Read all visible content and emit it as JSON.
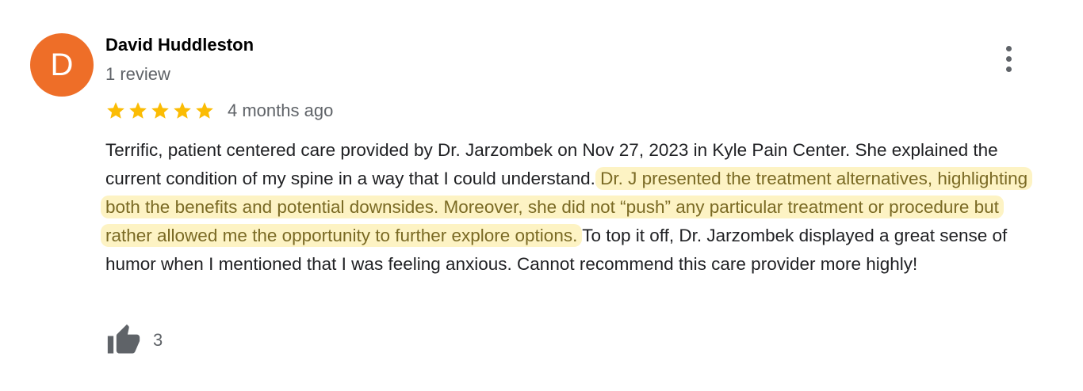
{
  "reviewer": {
    "initial": "D",
    "name": "David Huddleston",
    "review_count": "1 review",
    "avatar_color": "#ee6e28"
  },
  "rating": {
    "stars": 5,
    "max_stars": 5,
    "star_color": "#fbbc04",
    "icon": "star-icon"
  },
  "review": {
    "date": "4 months ago",
    "text_before": "Terrific, patient centered care provided by Dr. Jarzombek on Nov 27, 2023 in Kyle Pain Center. She explained the current condition of my spine in a way that I could understand. ",
    "text_highlighted": "Dr. J presented the treatment alternatives, highlighting both the benefits and potential downsides. Moreover, she did not “push” any particular treatment or procedure but rather allowed me the opportunity to further explore options.",
    "text_after": " To top it off, Dr. Jarzombek displayed a great sense of humor when I mentioned that I was feeling anxious. Cannot recommend this care provider more highly!",
    "highlight_color": "#fdf3c4"
  },
  "actions": {
    "like_icon": "thumbs-up-icon",
    "like_count": "3",
    "more_icon": "more-vert-icon"
  }
}
